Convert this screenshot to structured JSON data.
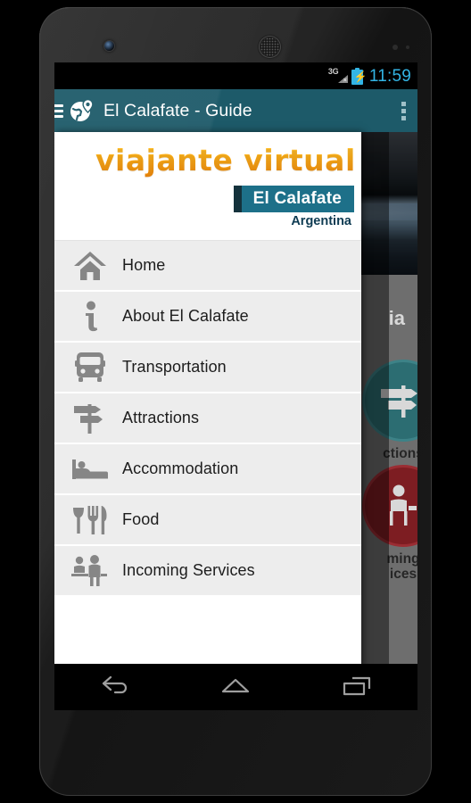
{
  "device": {
    "name": "android-phone",
    "status_bar": {
      "network_label": "3G",
      "network_state_icon": "signal-no-service-icon",
      "battery_icon": "battery-charging-icon",
      "time": "11:59"
    },
    "nav_bar": {
      "back_label": "Back",
      "home_label": "Home",
      "recents_label": "Recent apps"
    }
  },
  "app_bar": {
    "menu_icon": "hamburger-menu-icon",
    "logo_icon": "globe-location-pin-icon",
    "title": "El Calafate - Guide",
    "overflow_icon": "overflow-menu-icon"
  },
  "drawer": {
    "brand": "viajante virtual",
    "city": "El Calafate",
    "country": "Argentina",
    "items": [
      {
        "label": "Home",
        "icon": "home-icon"
      },
      {
        "label": "About El Calafate",
        "icon": "info-icon"
      },
      {
        "label": "Transportation",
        "icon": "bus-icon"
      },
      {
        "label": "Attractions",
        "icon": "signpost-icon"
      },
      {
        "label": "Accommodation",
        "icon": "bed-icon"
      },
      {
        "label": "Food",
        "icon": "cutlery-icon"
      },
      {
        "label": "Incoming Services",
        "icon": "people-icon"
      }
    ]
  },
  "background_content": {
    "hero_image_alt": "glacier-photo",
    "hero_caption": "ia",
    "tiles": [
      {
        "label": "ctions",
        "icon": "signpost-icon",
        "color": "#2c6d72"
      },
      {
        "label": "ming\nices",
        "icon": "person-desk-icon",
        "color": "#7d1d22"
      }
    ]
  },
  "colors": {
    "app_bar_teal": "#1d5a69",
    "badge_teal": "#1d7089",
    "badge_teal_dark": "#14323c",
    "brand_orange": "#ffb01a",
    "accent_blue": "#33b5e5",
    "drawer_item_bg": "#ededed",
    "tile_teal": "#2c6d72",
    "tile_red": "#7d1d22"
  }
}
